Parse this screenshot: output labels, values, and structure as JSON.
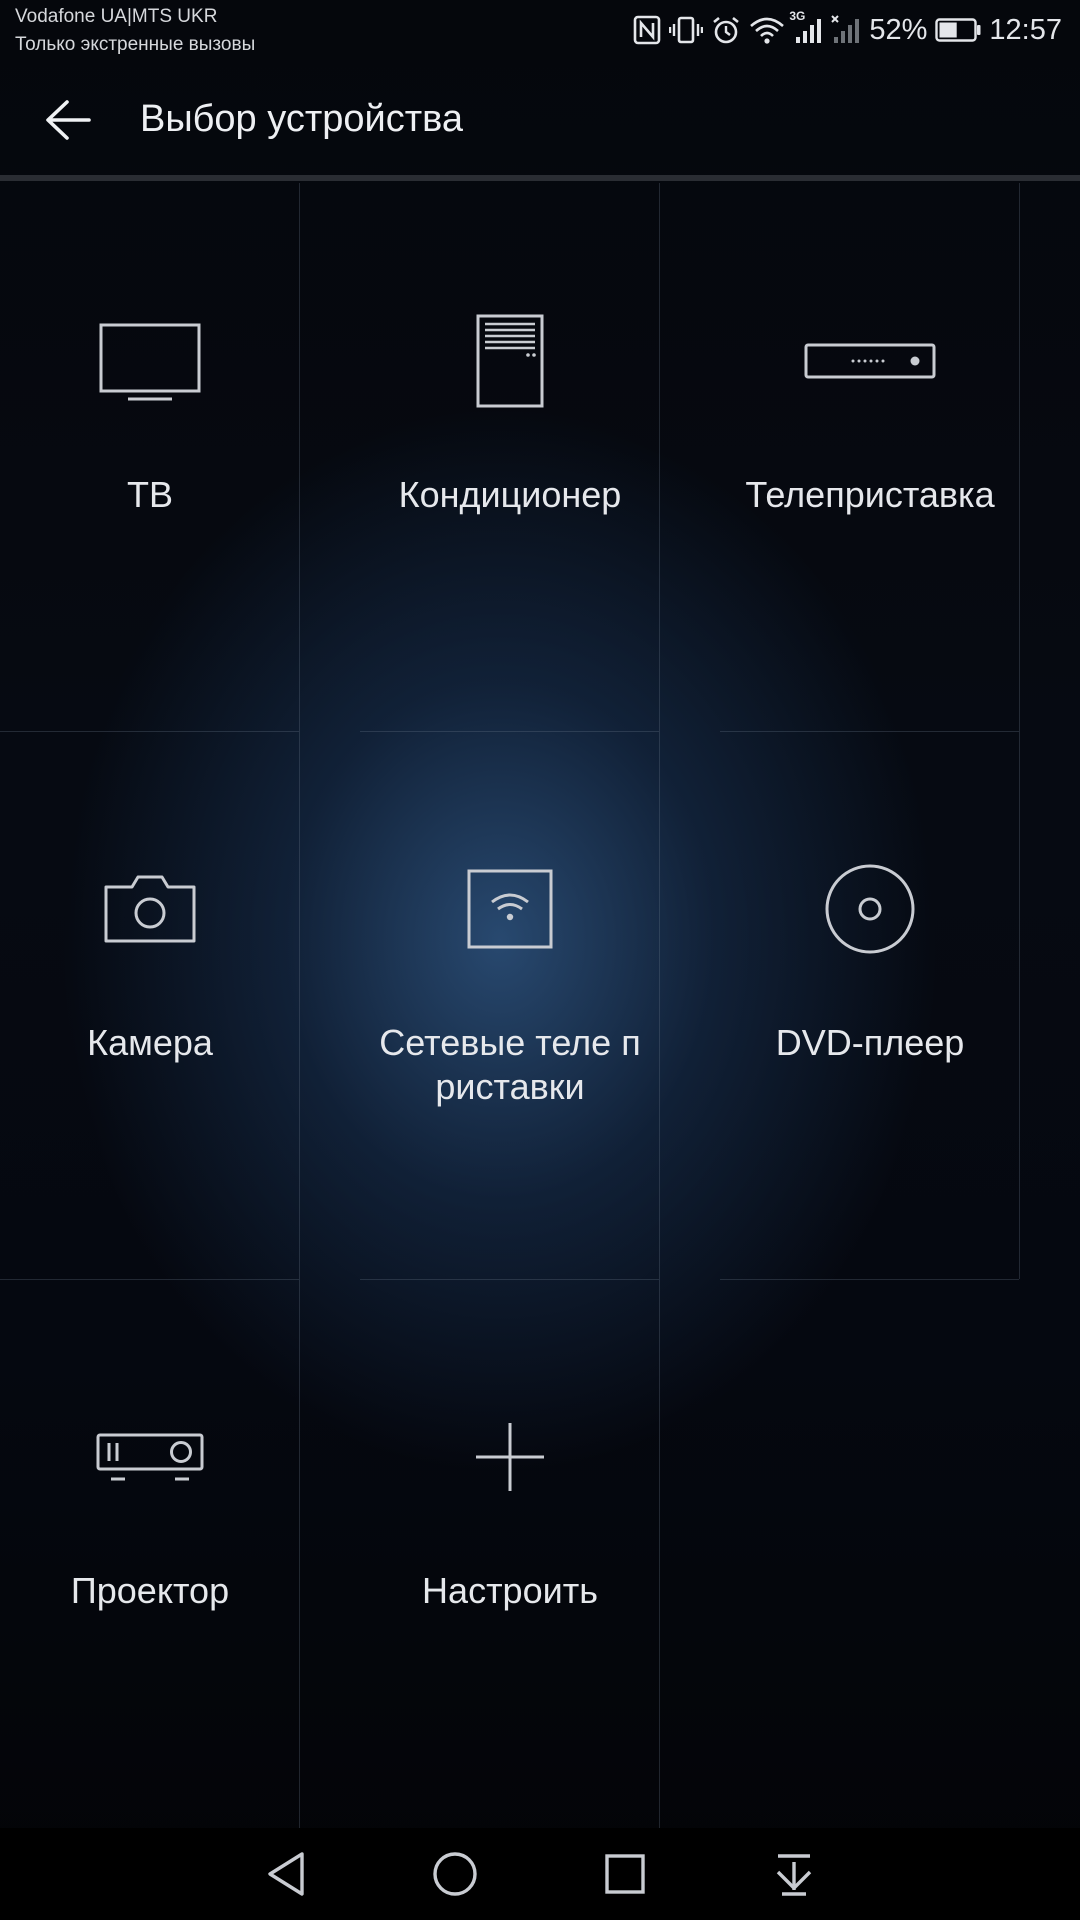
{
  "status_bar": {
    "carrier_line1": "Vodafone UA|MTS UKR",
    "carrier_line2": "Только экстренные вызовы",
    "network_type": "3G",
    "battery_percent": "52%",
    "time": "12:57",
    "battery_level": 0.52,
    "icons": [
      "nfc-icon",
      "vibrate-icon",
      "alarm-icon",
      "wifi-icon",
      "signal-icon",
      "signal-no-service-icon",
      "battery-icon"
    ]
  },
  "app_bar": {
    "back_icon": "arrow-left-icon",
    "title": "Выбор устройства"
  },
  "devices": [
    {
      "id": "tv",
      "label": "ТВ",
      "icon": "tv-icon"
    },
    {
      "id": "air-conditioner",
      "label": "Кондиционер",
      "icon": "air-conditioner-icon"
    },
    {
      "id": "set-top-box",
      "label": "Телеприставка",
      "icon": "set-top-box-icon"
    },
    {
      "id": "camera",
      "label": "Камера",
      "icon": "camera-icon"
    },
    {
      "id": "network-box",
      "label": "Сетевые теле приставки",
      "icon": "network-box-icon"
    },
    {
      "id": "dvd",
      "label": "DVD-плеер",
      "icon": "disc-icon"
    },
    {
      "id": "projector",
      "label": "Проектор",
      "icon": "projector-icon"
    },
    {
      "id": "custom",
      "label": "Настроить",
      "icon": "plus-icon"
    }
  ],
  "nav_bar": {
    "icons": [
      "nav-back-icon",
      "nav-home-icon",
      "nav-recents-icon",
      "nav-notifications-icon"
    ]
  },
  "colors": {
    "background": "#05070c",
    "glow": "#2e5480",
    "text": "#e6e8ec",
    "grid_line": "#4a5566"
  }
}
